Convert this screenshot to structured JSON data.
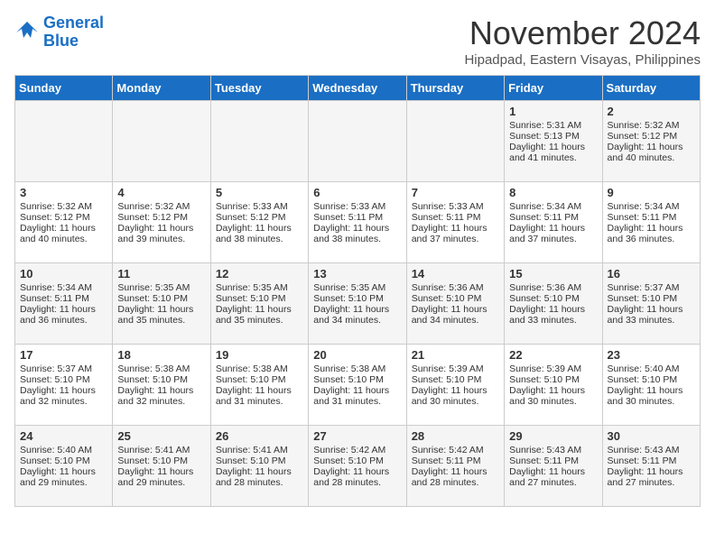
{
  "header": {
    "logo_line1": "General",
    "logo_line2": "Blue",
    "month": "November 2024",
    "location": "Hipadpad, Eastern Visayas, Philippines"
  },
  "weekdays": [
    "Sunday",
    "Monday",
    "Tuesday",
    "Wednesday",
    "Thursday",
    "Friday",
    "Saturday"
  ],
  "weeks": [
    [
      {
        "day": "",
        "info": ""
      },
      {
        "day": "",
        "info": ""
      },
      {
        "day": "",
        "info": ""
      },
      {
        "day": "",
        "info": ""
      },
      {
        "day": "",
        "info": ""
      },
      {
        "day": "1",
        "info": "Sunrise: 5:31 AM\nSunset: 5:13 PM\nDaylight: 11 hours\nand 41 minutes."
      },
      {
        "day": "2",
        "info": "Sunrise: 5:32 AM\nSunset: 5:12 PM\nDaylight: 11 hours\nand 40 minutes."
      }
    ],
    [
      {
        "day": "3",
        "info": "Sunrise: 5:32 AM\nSunset: 5:12 PM\nDaylight: 11 hours\nand 40 minutes."
      },
      {
        "day": "4",
        "info": "Sunrise: 5:32 AM\nSunset: 5:12 PM\nDaylight: 11 hours\nand 39 minutes."
      },
      {
        "day": "5",
        "info": "Sunrise: 5:33 AM\nSunset: 5:12 PM\nDaylight: 11 hours\nand 38 minutes."
      },
      {
        "day": "6",
        "info": "Sunrise: 5:33 AM\nSunset: 5:11 PM\nDaylight: 11 hours\nand 38 minutes."
      },
      {
        "day": "7",
        "info": "Sunrise: 5:33 AM\nSunset: 5:11 PM\nDaylight: 11 hours\nand 37 minutes."
      },
      {
        "day": "8",
        "info": "Sunrise: 5:34 AM\nSunset: 5:11 PM\nDaylight: 11 hours\nand 37 minutes."
      },
      {
        "day": "9",
        "info": "Sunrise: 5:34 AM\nSunset: 5:11 PM\nDaylight: 11 hours\nand 36 minutes."
      }
    ],
    [
      {
        "day": "10",
        "info": "Sunrise: 5:34 AM\nSunset: 5:11 PM\nDaylight: 11 hours\nand 36 minutes."
      },
      {
        "day": "11",
        "info": "Sunrise: 5:35 AM\nSunset: 5:10 PM\nDaylight: 11 hours\nand 35 minutes."
      },
      {
        "day": "12",
        "info": "Sunrise: 5:35 AM\nSunset: 5:10 PM\nDaylight: 11 hours\nand 35 minutes."
      },
      {
        "day": "13",
        "info": "Sunrise: 5:35 AM\nSunset: 5:10 PM\nDaylight: 11 hours\nand 34 minutes."
      },
      {
        "day": "14",
        "info": "Sunrise: 5:36 AM\nSunset: 5:10 PM\nDaylight: 11 hours\nand 34 minutes."
      },
      {
        "day": "15",
        "info": "Sunrise: 5:36 AM\nSunset: 5:10 PM\nDaylight: 11 hours\nand 33 minutes."
      },
      {
        "day": "16",
        "info": "Sunrise: 5:37 AM\nSunset: 5:10 PM\nDaylight: 11 hours\nand 33 minutes."
      }
    ],
    [
      {
        "day": "17",
        "info": "Sunrise: 5:37 AM\nSunset: 5:10 PM\nDaylight: 11 hours\nand 32 minutes."
      },
      {
        "day": "18",
        "info": "Sunrise: 5:38 AM\nSunset: 5:10 PM\nDaylight: 11 hours\nand 32 minutes."
      },
      {
        "day": "19",
        "info": "Sunrise: 5:38 AM\nSunset: 5:10 PM\nDaylight: 11 hours\nand 31 minutes."
      },
      {
        "day": "20",
        "info": "Sunrise: 5:38 AM\nSunset: 5:10 PM\nDaylight: 11 hours\nand 31 minutes."
      },
      {
        "day": "21",
        "info": "Sunrise: 5:39 AM\nSunset: 5:10 PM\nDaylight: 11 hours\nand 30 minutes."
      },
      {
        "day": "22",
        "info": "Sunrise: 5:39 AM\nSunset: 5:10 PM\nDaylight: 11 hours\nand 30 minutes."
      },
      {
        "day": "23",
        "info": "Sunrise: 5:40 AM\nSunset: 5:10 PM\nDaylight: 11 hours\nand 30 minutes."
      }
    ],
    [
      {
        "day": "24",
        "info": "Sunrise: 5:40 AM\nSunset: 5:10 PM\nDaylight: 11 hours\nand 29 minutes."
      },
      {
        "day": "25",
        "info": "Sunrise: 5:41 AM\nSunset: 5:10 PM\nDaylight: 11 hours\nand 29 minutes."
      },
      {
        "day": "26",
        "info": "Sunrise: 5:41 AM\nSunset: 5:10 PM\nDaylight: 11 hours\nand 28 minutes."
      },
      {
        "day": "27",
        "info": "Sunrise: 5:42 AM\nSunset: 5:10 PM\nDaylight: 11 hours\nand 28 minutes."
      },
      {
        "day": "28",
        "info": "Sunrise: 5:42 AM\nSunset: 5:11 PM\nDaylight: 11 hours\nand 28 minutes."
      },
      {
        "day": "29",
        "info": "Sunrise: 5:43 AM\nSunset: 5:11 PM\nDaylight: 11 hours\nand 27 minutes."
      },
      {
        "day": "30",
        "info": "Sunrise: 5:43 AM\nSunset: 5:11 PM\nDaylight: 11 hours\nand 27 minutes."
      }
    ]
  ]
}
